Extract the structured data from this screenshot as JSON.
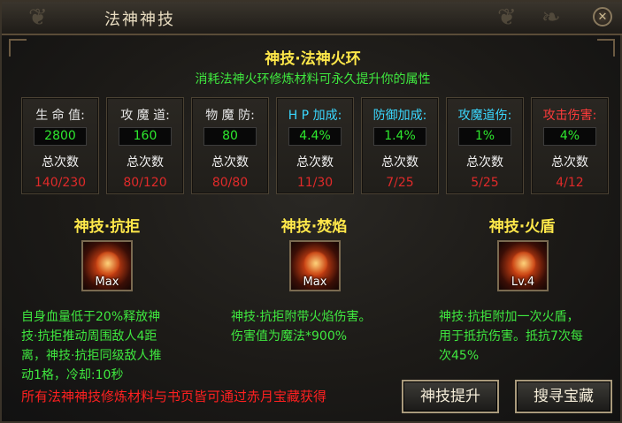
{
  "window": {
    "title": "法神神技",
    "close_symbol": "✕"
  },
  "header": {
    "skill_title": "神技·法神火环",
    "subtitle": "消耗法神火环修炼材料可永久提升你的属性"
  },
  "stats": [
    {
      "label": "生 命 值:",
      "value": "2800",
      "total_label": "总次数",
      "count": "140/230",
      "label_color": "#e6e6e6"
    },
    {
      "label": "攻 魔 道:",
      "value": "160",
      "total_label": "总次数",
      "count": "80/120",
      "label_color": "#e6e6e6"
    },
    {
      "label": "物 魔 防:",
      "value": "80",
      "total_label": "总次数",
      "count": "80/80",
      "label_color": "#e6e6e6"
    },
    {
      "label": "H P 加成:",
      "value": "4.4%",
      "total_label": "总次数",
      "count": "11/30",
      "label_color": "#3ad8ff"
    },
    {
      "label": "防御加成:",
      "value": "1.4%",
      "total_label": "总次数",
      "count": "7/25",
      "label_color": "#3ad8ff"
    },
    {
      "label": "攻魔道伤:",
      "value": "1%",
      "total_label": "总次数",
      "count": "5/25",
      "label_color": "#3ad8ff"
    },
    {
      "label": "攻击伤害:",
      "value": "4%",
      "total_label": "总次数",
      "count": "4/12",
      "label_color": "#ff3b3b"
    }
  ],
  "skills": [
    {
      "name": "神技·抗拒",
      "level": "Max",
      "icon": "resist-skill-icon",
      "description": "自身血量低于20%释放神\n技·抗拒推动周围敌人4距\n离，神技·抗拒同级敌人推\n动1格，冷却:10秒"
    },
    {
      "name": "神技·焚焰",
      "level": "Max",
      "icon": "flame-skill-icon",
      "description": "神技·抗拒附带火焰伤害。\n伤害值为魔法*900%"
    },
    {
      "name": "神技·火盾",
      "level": "Lv.4",
      "icon": "fire-shield-skill-icon",
      "description": "神技·抗拒附加一次火盾，\n用于抵抗伤害。抵抗7次每\n次45%"
    }
  ],
  "footer": {
    "note": "所有法神神技修炼材料与书页皆可通过赤月宝藏获得"
  },
  "buttons": {
    "upgrade": "神技提升",
    "search": "搜寻宝藏"
  }
}
